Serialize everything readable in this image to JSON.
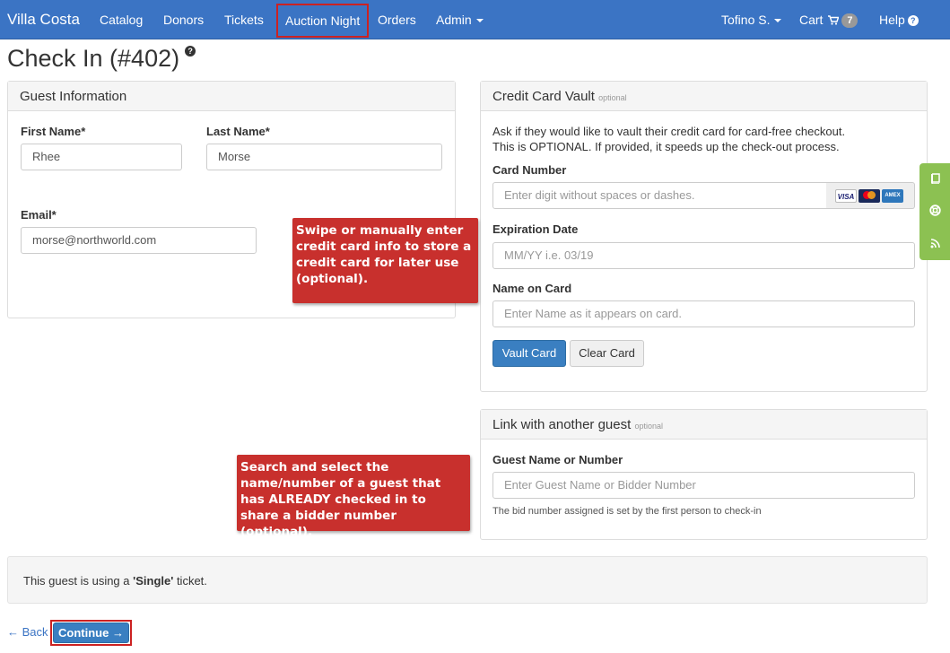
{
  "nav": {
    "brand": "Villa Costa",
    "items": [
      "Catalog",
      "Donors",
      "Tickets",
      "Auction Night",
      "Orders",
      "Admin"
    ],
    "user": "Tofino S.",
    "cart": "Cart",
    "cart_count": "7",
    "help": "Help"
  },
  "page": {
    "title": "Check In (#402)"
  },
  "guest": {
    "heading": "Guest Information",
    "first_name_label": "First Name*",
    "first_name": "Rhee",
    "last_name_label": "Last Name*",
    "last_name": "Morse",
    "email_label": "Email*",
    "email": "morse@northworld.com"
  },
  "vault": {
    "heading": "Credit Card Vault",
    "heading_note": "optional",
    "intro_1": "Ask if they would like to vault their credit card for card-free checkout.",
    "intro_2": "This is OPTIONAL. If provided, it speeds up the check-out process.",
    "card_number_label": "Card Number",
    "card_number_placeholder": "Enter digit without spaces or dashes.",
    "expiration_label": "Expiration Date",
    "expiration_placeholder": "MM/YY i.e. 03/19",
    "name_label": "Name on Card",
    "name_placeholder": "Enter Name as it appears on card.",
    "vault_button": "Vault Card",
    "clear_button": "Clear Card",
    "card_logos": [
      "VISA",
      "mastercard",
      "AMEX"
    ]
  },
  "link": {
    "heading": "Link with another guest",
    "heading_note": "optional",
    "label": "Guest Name or Number",
    "placeholder": "Enter Guest Name or Bidder Number",
    "help": "The bid number assigned is set by the first person to check-in"
  },
  "callouts": {
    "card": "Swipe or manually enter credit card info to store a credit card for later use (optional).",
    "guest": "Search and select the name/number of a guest that has ALREADY checked in to share a bidder number (optional)."
  },
  "ticket": {
    "prefix": "This guest is using a ",
    "type": "'Single'",
    "suffix": " ticket."
  },
  "footer": {
    "back": "← Back",
    "continue": "Continue →"
  },
  "colors": {
    "navbar": "#3b74c4",
    "primary": "#3a7fc1",
    "callout": "#c8302d",
    "highlight_outline": "#cc2222",
    "side_tabs": "#8cc152"
  },
  "side_tabs": [
    "book-icon",
    "lifebuoy-icon",
    "rss-icon"
  ]
}
